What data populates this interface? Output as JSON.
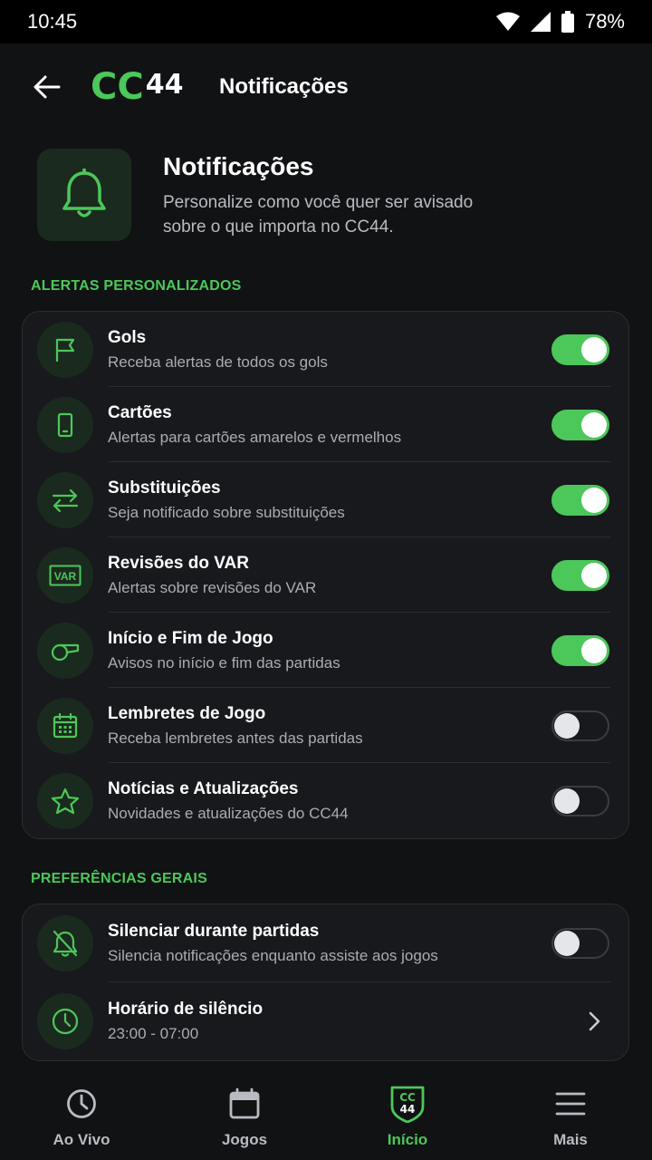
{
  "status": {
    "time": "10:45",
    "battery": "78%"
  },
  "header": {
    "logo_text": "CC",
    "logo_num": "44",
    "title": "Notificações"
  },
  "hero": {
    "title": "Notificações",
    "description": "Personalize como você quer ser avisado sobre o que importa no CC44."
  },
  "alerts": {
    "section_label": "ALERTAS PERSONALIZADOS",
    "items": [
      {
        "icon": "flag-icon",
        "title": "Gols",
        "subtitle": "Receba alertas de todos os gols",
        "enabled": true
      },
      {
        "icon": "card-icon",
        "title": "Cartões",
        "subtitle": "Alertas para cartões amarelos e vermelhos",
        "enabled": true
      },
      {
        "icon": "swap-icon",
        "title": "Substituições",
        "subtitle": "Seja notificado sobre substituições",
        "enabled": true
      },
      {
        "icon": "var-icon",
        "title": "Revisões do VAR",
        "subtitle": "Alertas sobre revisões do VAR",
        "enabled": true,
        "icon_text": "VAR"
      },
      {
        "icon": "whistle-icon",
        "title": "Início e Fim de Jogo",
        "subtitle": "Avisos no início e fim das partidas",
        "enabled": true
      },
      {
        "icon": "calendar-icon",
        "title": "Lembretes de Jogo",
        "subtitle": "Receba lembretes antes das partidas",
        "enabled": false
      },
      {
        "icon": "star-icon",
        "title": "Notícias e Atualizações",
        "subtitle": "Novidades e atualizações do CC44",
        "enabled": false
      }
    ]
  },
  "general": {
    "section_label": "PREFERÊNCIAS GERAIS",
    "mute": {
      "icon": "bell-off-icon",
      "title": "Silenciar durante partidas",
      "subtitle": "Silencia notificações enquanto assiste aos jogos",
      "enabled": false
    },
    "quiet_hours": {
      "icon": "clock-icon",
      "title": "Horário de silêncio",
      "subtitle": "23:00 - 07:00"
    }
  },
  "nav": {
    "items": [
      {
        "icon": "clock-icon",
        "label": "Ao Vivo"
      },
      {
        "icon": "calendar-icon",
        "label": "Jogos"
      },
      {
        "icon": "cc44-shield-icon",
        "label": "Início",
        "active": true,
        "badge_top": "CC",
        "badge_bottom": "44"
      },
      {
        "icon": "menu-icon",
        "label": "Mais"
      }
    ]
  },
  "colors": {
    "accent": "#4cc75a",
    "background": "#111214",
    "card": "#17191c"
  }
}
